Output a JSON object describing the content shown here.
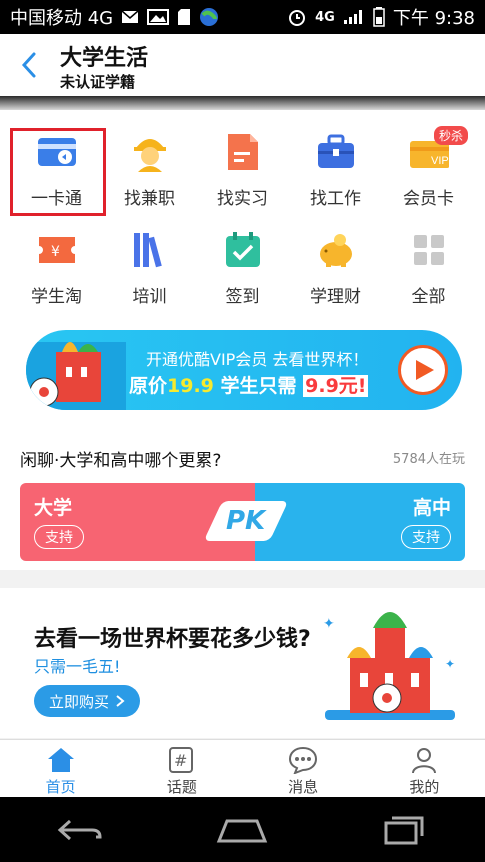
{
  "status_bar": {
    "carrier": "中国移动 4G",
    "network": "4G",
    "time": "下午 9:38"
  },
  "header": {
    "title": "大学生活",
    "subtitle": "未认证学籍"
  },
  "services": [
    {
      "label": "一卡通",
      "icon": "card-icon"
    },
    {
      "label": "找兼职",
      "icon": "worker-icon"
    },
    {
      "label": "找实习",
      "icon": "document-icon"
    },
    {
      "label": "找工作",
      "icon": "briefcase-icon"
    },
    {
      "label": "会员卡",
      "icon": "vip-card-icon",
      "badge": "秒杀"
    },
    {
      "label": "学生淘",
      "icon": "coupon-icon"
    },
    {
      "label": "培训",
      "icon": "books-icon"
    },
    {
      "label": "签到",
      "icon": "calendar-check-icon"
    },
    {
      "label": "学理财",
      "icon": "piggy-bank-icon"
    },
    {
      "label": "全部",
      "icon": "grid-icon"
    }
  ],
  "banner": {
    "line1": "开通优酷VIP会员 去看世界杯！",
    "line2_prefix": "原价",
    "old_price": "19.9",
    "line2_mid": " 学生只需 ",
    "new_price": "9.9元!"
  },
  "pk": {
    "question": "闲聊·大学和高中哪个更累?",
    "count": "5784人在玩",
    "left_label": "大学",
    "right_label": "高中",
    "support": "支持",
    "badge": "PK"
  },
  "ad": {
    "headline": "去看一场世界杯要花多少钱?",
    "sub": "只需一毛五!",
    "button": "立即购买"
  },
  "tabs": [
    {
      "label": "首页",
      "icon": "home-icon",
      "active": true
    },
    {
      "label": "话题",
      "icon": "hashtag-icon",
      "active": false
    },
    {
      "label": "消息",
      "icon": "message-icon",
      "active": false
    },
    {
      "label": "我的",
      "icon": "user-icon",
      "active": false
    }
  ],
  "colors": {
    "accent": "#2b8fe6",
    "pk_left": "#f76472",
    "pk_right": "#29b3ed",
    "highlight": "#e0212b"
  }
}
